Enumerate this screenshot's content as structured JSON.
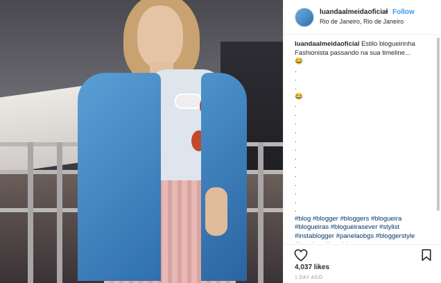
{
  "post": {
    "username": "luandaalmeidaoficial",
    "separator": "•",
    "follow_label": "Follow",
    "location": "Rio de Janeiro, Rio de Janeiro"
  },
  "caption": {
    "username": "luandaalmeidaoficial",
    "text": "Estilo blogueirinha Fashionista passando na sua timeline...",
    "emoji1": "😂",
    "emoji2": "😂",
    "dot": ".",
    "hashtags": "#blog #blogger #bloggers #blogueira #blogueiras #blogueirasever #stylist #instablogger #panelaobgs #bloggerstyle #instabgs #instablog"
  },
  "stats": {
    "likes": "4,037 likes",
    "time": "1 DAY AGO"
  },
  "icons": {
    "avatar": "profile-avatar",
    "like": "heart-icon",
    "save": "bookmark-icon"
  },
  "colors": {
    "link": "#3897f0",
    "hashtag": "#003569",
    "border": "#efefef"
  }
}
